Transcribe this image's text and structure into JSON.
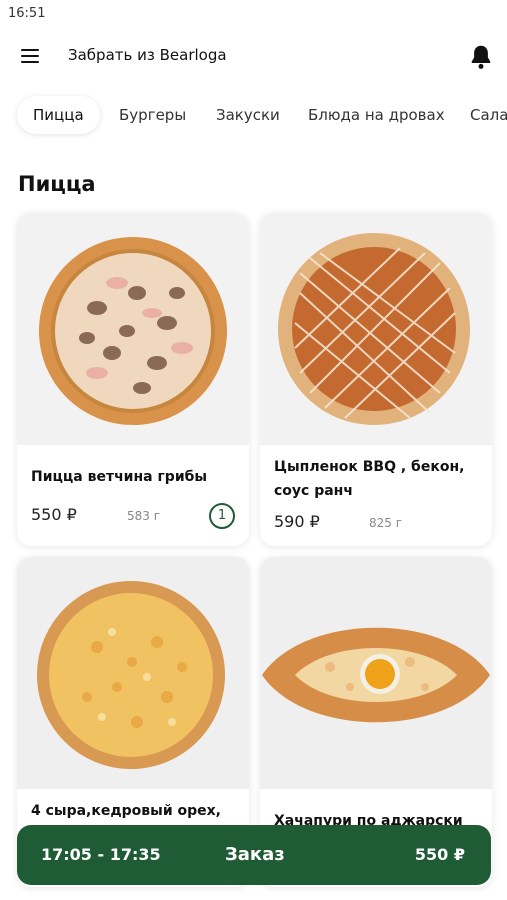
{
  "status_bar": {
    "time": "16:51"
  },
  "header": {
    "title": "Забрать из Bearloga"
  },
  "tabs": [
    {
      "label": "Пицца",
      "active": true
    },
    {
      "label": "Бургеры",
      "active": false
    },
    {
      "label": "Закуски",
      "active": false
    },
    {
      "label": "Блюда на дровах",
      "active": false
    },
    {
      "label": "Сала",
      "active": false
    }
  ],
  "section": {
    "title": "Пицца"
  },
  "products": [
    {
      "name_line1": "Пицца ветчина грибы",
      "name_line2": "",
      "price": "550 ₽",
      "weight": "583 г",
      "qty": "1"
    },
    {
      "name_line1": "Цыпленок BBQ , бекон,",
      "name_line2": "соус ранч",
      "price": "590 ₽",
      "weight": "825 г"
    },
    {
      "name_line1": "4 сыра,кедровый орех,",
      "name_line2": ""
    },
    {
      "name_line1": "Хачапури по аджарски",
      "name_line2": ""
    }
  ],
  "order": {
    "time": "17:05 - 17:35",
    "label": "Заказ",
    "total": "550 ₽"
  },
  "colors": {
    "accent": "#1f5c36",
    "background": "#ffffff",
    "card": "#ffffff"
  },
  "icons": {
    "menu": "hamburger-icon",
    "bell": "bell-icon"
  }
}
